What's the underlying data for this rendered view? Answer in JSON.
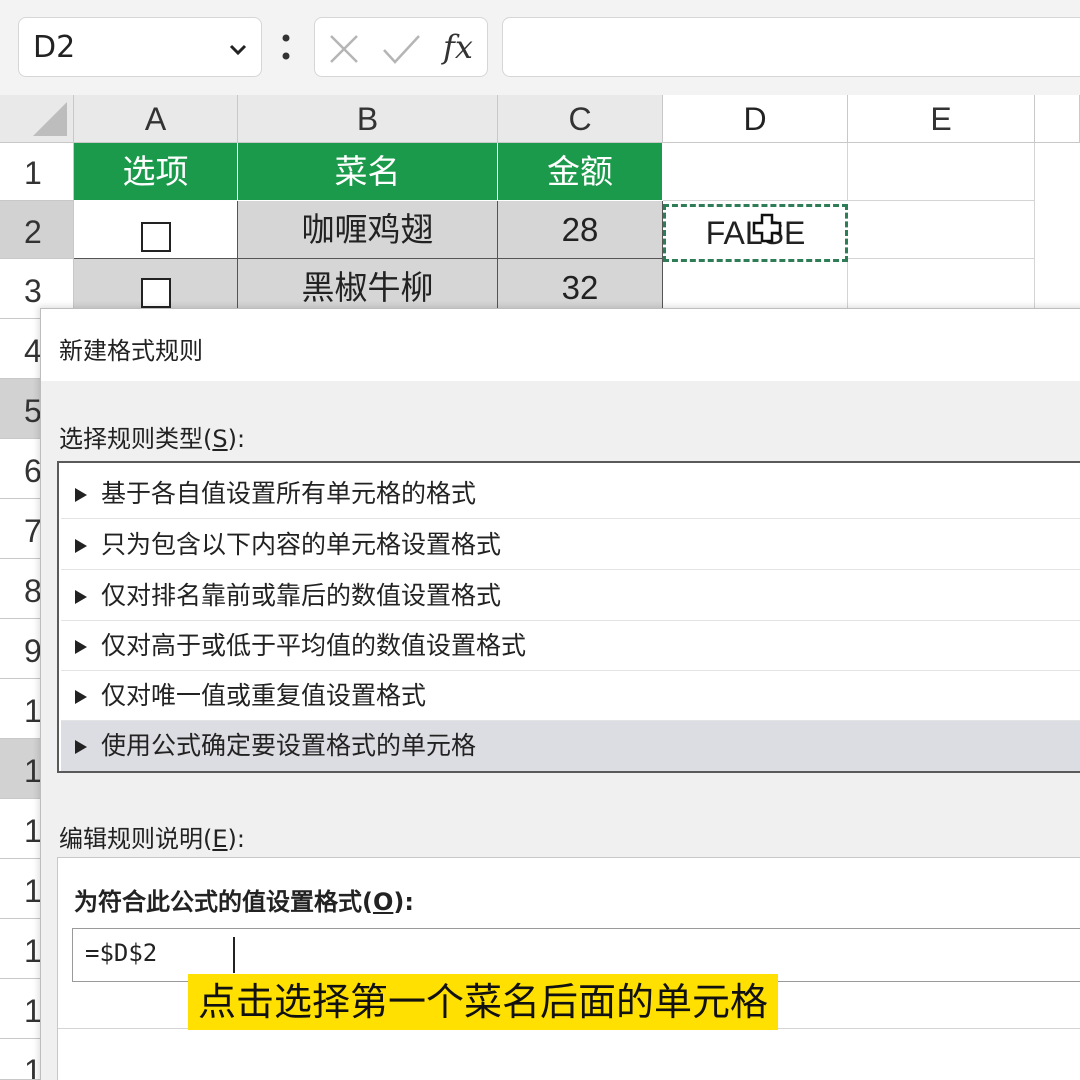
{
  "formula_bar": {
    "name_box": "D2",
    "fx": "fx",
    "formula": ""
  },
  "grid": {
    "columns": [
      "A",
      "B",
      "C",
      "D",
      "E"
    ],
    "rows": [
      "1",
      "2",
      "3",
      "4",
      "5",
      "6",
      "7",
      "8",
      "9",
      "1",
      "1",
      "1",
      "1",
      "1",
      "1",
      "1"
    ],
    "header_row": [
      "选项",
      "菜名",
      "金额"
    ],
    "data_rows": [
      {
        "item": "咖喱鸡翅",
        "amount": "28",
        "checked": false
      },
      {
        "item": "黑椒牛柳",
        "amount": "32",
        "checked": false
      }
    ],
    "d2_value": "FALSE",
    "colors": {
      "header_fill": "#1a9a4a",
      "selection_border": "#2f7d57"
    }
  },
  "dialog": {
    "title": "新建格式规则",
    "select_type_label": "选择规则类型(",
    "select_type_key": "S",
    "select_type_suffix": "):",
    "rule_types": [
      "基于各自值设置所有单元格的格式",
      "只为包含以下内容的单元格设置格式",
      "仅对排名靠前或靠后的数值设置格式",
      "仅对高于或低于平均值的数值设置格式",
      "仅对唯一值或重复值设置格式",
      "使用公式确定要设置格式的单元格"
    ],
    "selected_rule_index": 5,
    "edit_label": "编辑规则说明(",
    "edit_key": "E",
    "edit_suffix": "):",
    "formula_title": "为符合此公式的值设置格式(",
    "formula_key": "O",
    "formula_suffix": "):",
    "formula_value": "=$D$2"
  },
  "subtitle": "点击选择第一个菜名后面的单元格"
}
